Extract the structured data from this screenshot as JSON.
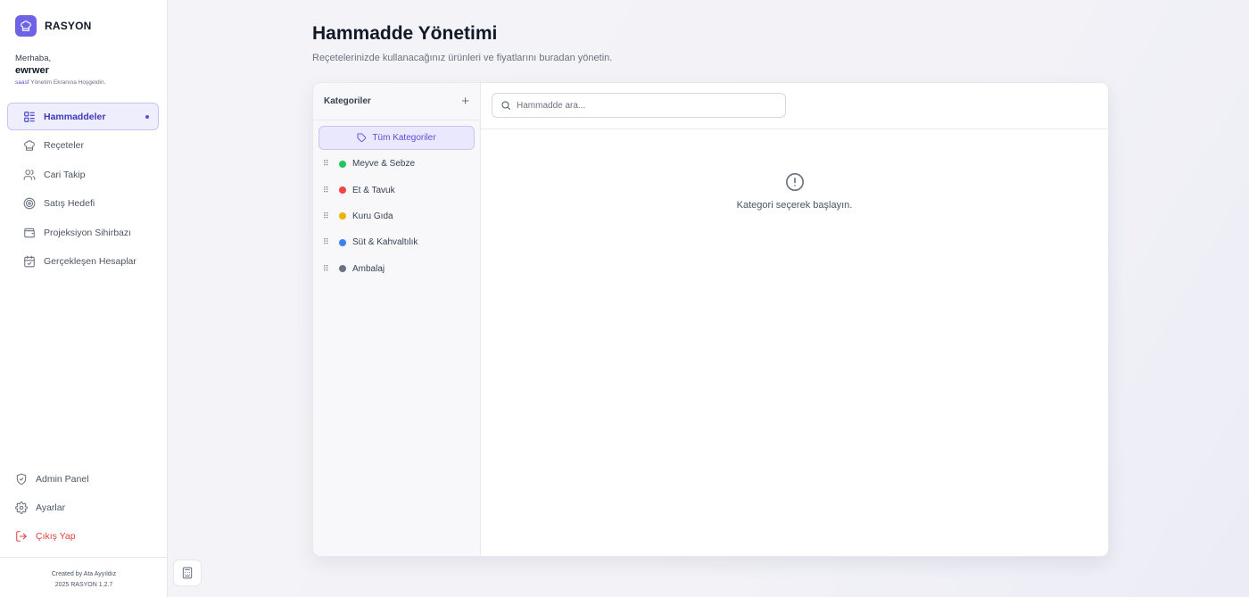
{
  "brand": {
    "name": "RASYON",
    "accent": "#6c63e6"
  },
  "user": {
    "greeting": "Merhaba,",
    "name": "ewrwer",
    "sub_highlight": "saasf",
    "sub_text": " Yönetim Ekranına Hoşgeldin."
  },
  "nav": [
    {
      "label": "Hammaddeler",
      "icon": "list-icon",
      "active": true
    },
    {
      "label": "Reçeteler",
      "icon": "chef-hat-icon"
    },
    {
      "label": "Cari Takip",
      "icon": "users-icon"
    },
    {
      "label": "Satış Hedefi",
      "icon": "target-icon"
    },
    {
      "label": "Projeksiyon Sihirbazı",
      "icon": "wallet-icon"
    },
    {
      "label": "Gerçekleşen Hesaplar",
      "icon": "calendar-check-icon"
    }
  ],
  "bottom_nav": [
    {
      "label": "Admin Panel",
      "icon": "shield-icon"
    },
    {
      "label": "Ayarlar",
      "icon": "gear-icon"
    },
    {
      "label": "Çıkış Yap",
      "icon": "logout-icon",
      "color": "#e0413d"
    }
  ],
  "footer": {
    "line1": "Created by Ata Ayyıldız",
    "line2": "2025 RASYON 1.2.7"
  },
  "page": {
    "title": "Hammadde Yönetimi",
    "subtitle": "Reçetelerinizde kullanacağınız ürünleri ve fiyatlarını buradan yönetin."
  },
  "categories": {
    "header": "Kategoriler",
    "add_label": "+",
    "all_label": "Tüm Kategoriler",
    "items": [
      {
        "label": "Meyve & Sebze",
        "color": "#22c55e"
      },
      {
        "label": "Et & Tavuk",
        "color": "#ef4444"
      },
      {
        "label": "Kuru Gıda",
        "color": "#eab308"
      },
      {
        "label": "Süt & Kahvaltılık",
        "color": "#3b82f6"
      },
      {
        "label": "Ambalaj",
        "color": "#6b7280"
      }
    ]
  },
  "search": {
    "placeholder": "Hammadde ara..."
  },
  "empty_state": {
    "message": "Kategori seçerek başlayın."
  }
}
